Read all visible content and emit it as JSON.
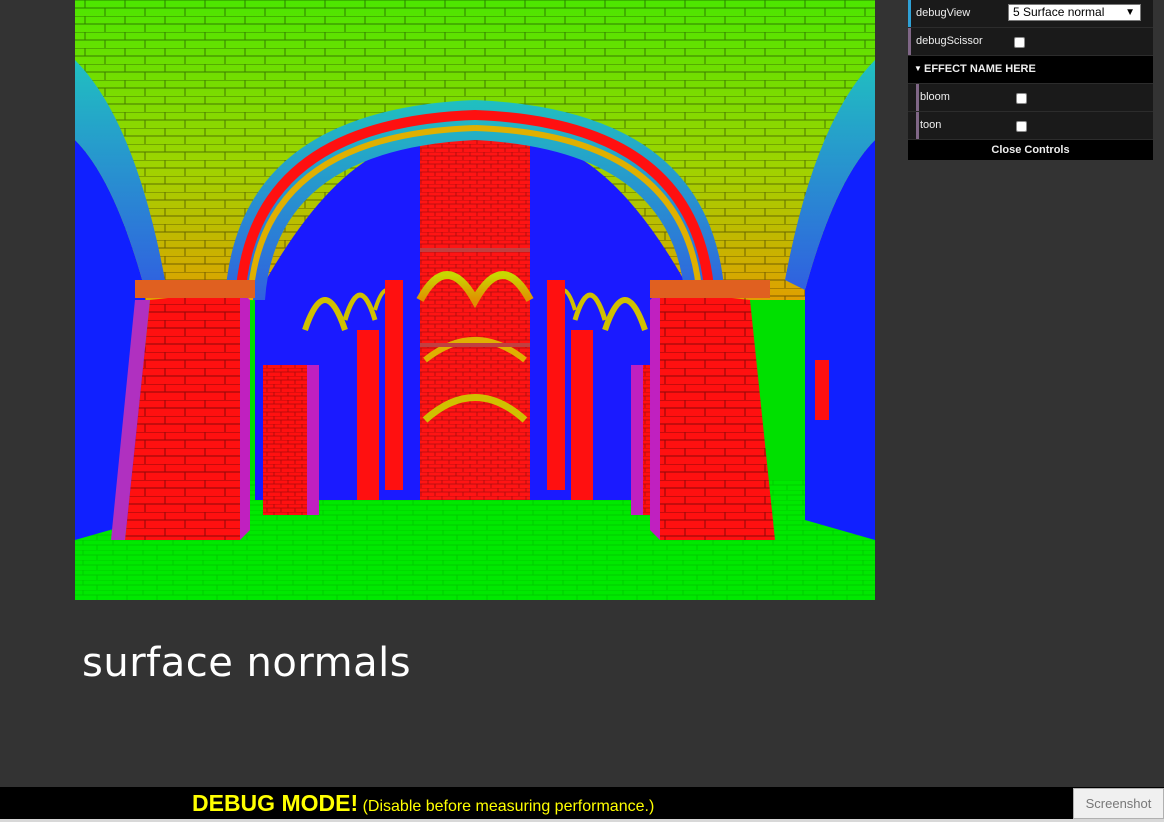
{
  "gui": {
    "debug_view_label": "debugView",
    "debug_view_value": "5 Surface normal",
    "debug_scissor_label": "debugScissor",
    "folder_title": "EFFECT NAME HERE",
    "bloom_label": "bloom",
    "toon_label": "toon",
    "close_label": "Close Controls",
    "accent_colors": {
      "select": "#1ed36f",
      "checkbox": "#806787",
      "folder_item": "#806787"
    }
  },
  "caption": "surface normals",
  "debug_bar": {
    "strong": "DEBUG MODE!",
    "note": "(Disable before measuring performance.)",
    "text_color": "#ffff00"
  },
  "screenshot_button": "Screenshot",
  "viewport": {
    "description_icon": "rendered-scene-icon",
    "palette": {
      "floor": "#00e000",
      "vault": "#60e000",
      "pillar": "#ff1010",
      "shadow": "#1010ff",
      "magenta": "#c020c0",
      "cyan": "#10b0d0"
    }
  }
}
